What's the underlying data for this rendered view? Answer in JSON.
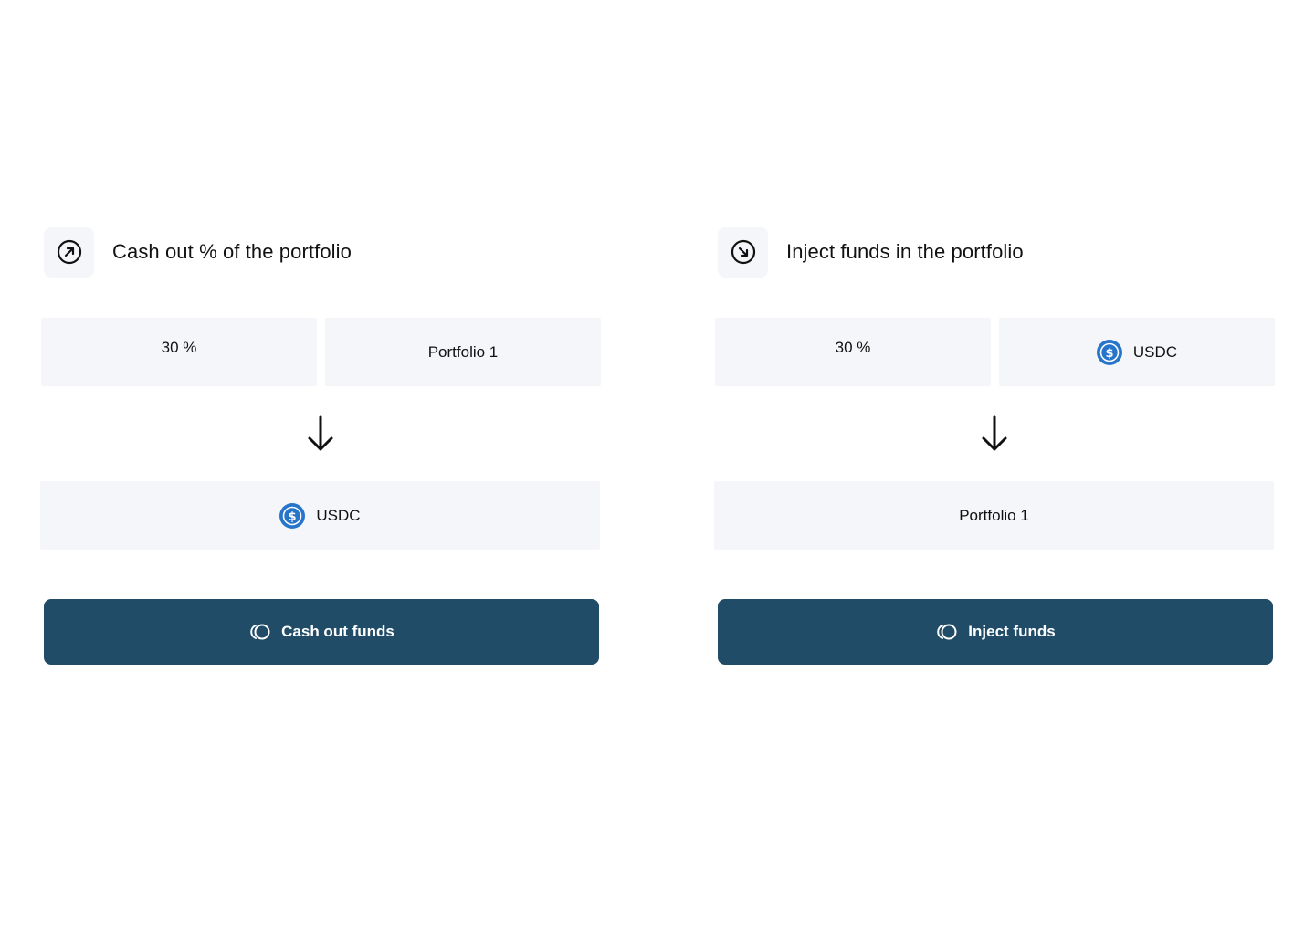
{
  "cash_out": {
    "icon": "arrow-up-right-circle-icon",
    "title": "Cash out % of the portfolio",
    "percent": "30 %",
    "source": "Portfolio 1",
    "destination": {
      "label": "USDC",
      "icon": "usdc-icon"
    },
    "button": {
      "icon": "coins-icon",
      "label": "Cash out funds"
    }
  },
  "inject": {
    "icon": "arrow-down-right-circle-icon",
    "title": "Inject funds in the portfolio",
    "percent": "30 %",
    "source": {
      "label": "USDC",
      "icon": "usdc-icon"
    },
    "destination": "Portfolio 1",
    "button": {
      "icon": "coins-icon",
      "label": "Inject funds"
    }
  },
  "colors": {
    "button_bg": "#214c67",
    "field_bg": "#f5f6f9",
    "usdc_blue": "#2775ca"
  }
}
